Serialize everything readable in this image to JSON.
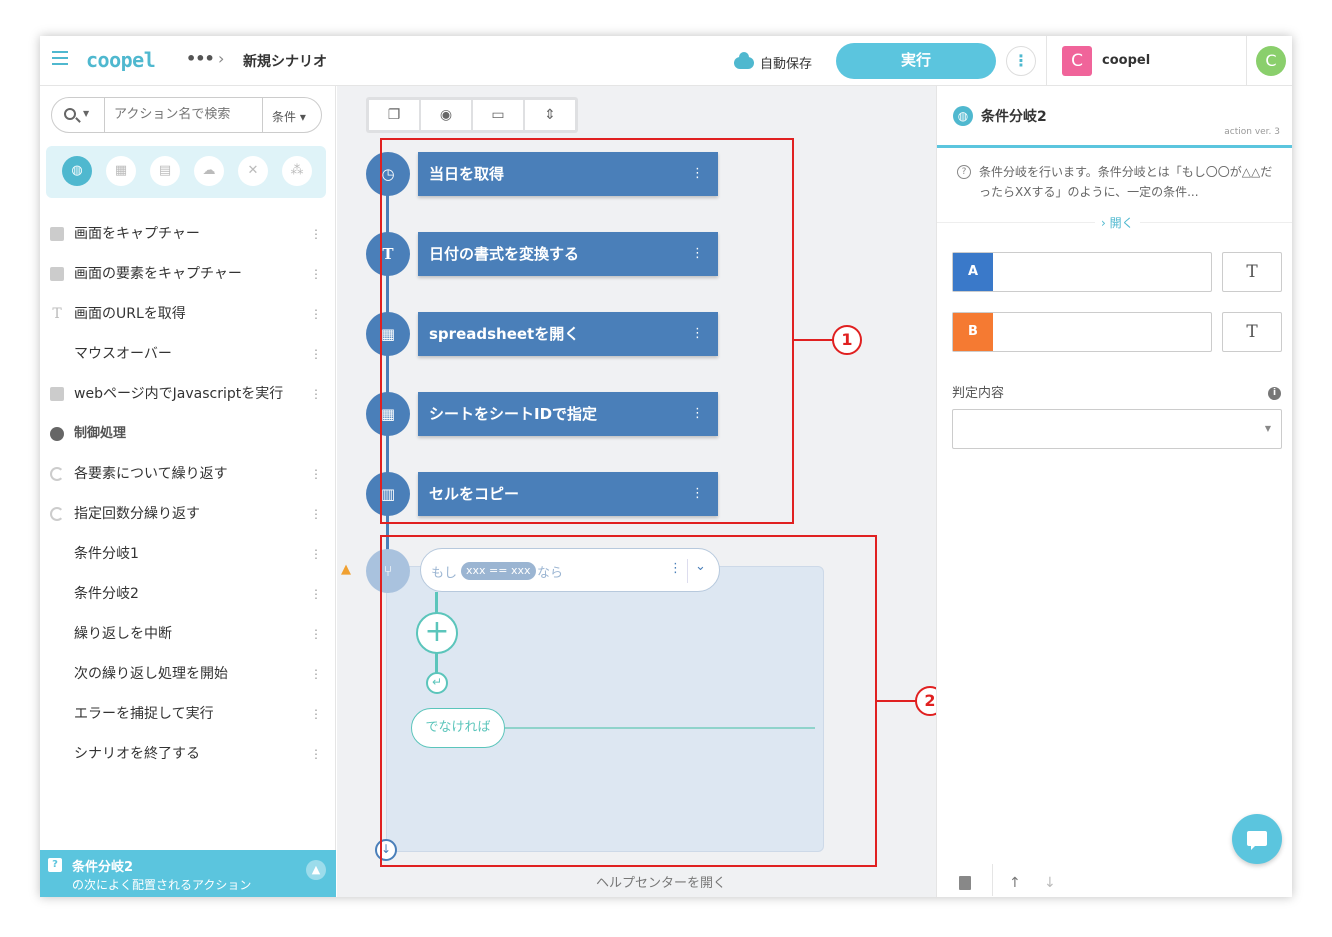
{
  "header": {
    "logo": "coopel",
    "more": "•••",
    "separator": "›",
    "title": "新規シナリオ",
    "autosave": "自動保存",
    "run": "実行",
    "kebab": "⋮",
    "workspace_initial": "C",
    "workspace_name": "coopel",
    "user_initial": "C"
  },
  "sidebar": {
    "search_placeholder": "アクション名で検索",
    "condition_filter": "条件",
    "items": [
      {
        "label": "画面をキャプチャー"
      },
      {
        "label": "画面の要素をキャプチャー"
      },
      {
        "label": "画面のURLを取得"
      },
      {
        "label": "マウスオーバー"
      },
      {
        "label": "webページ内でJavascriptを実行"
      },
      {
        "label": "制御処理"
      },
      {
        "label": "各要素について繰り返す"
      },
      {
        "label": "指定回数分繰り返す"
      },
      {
        "label": "条件分岐1"
      },
      {
        "label": "条件分岐2"
      },
      {
        "label": "繰り返しを中断"
      },
      {
        "label": "次の繰り返し処理を開始"
      },
      {
        "label": "エラーを捕捉して実行"
      },
      {
        "label": "シナリオを終了する"
      }
    ],
    "suggestion_title": "条件分岐2",
    "suggestion_sub": "の次によく配置されるアクション"
  },
  "canvas": {
    "actions": [
      {
        "label": "当日を取得"
      },
      {
        "label": "日付の書式を変換する"
      },
      {
        "label": "spreadsheetを開く"
      },
      {
        "label": "シートをシートIDで指定"
      },
      {
        "label": "セルをコピー"
      }
    ],
    "condition": {
      "if_text": "もし",
      "expr": "xxx == xxx",
      "then_text": "なら",
      "else_text": "でなければ"
    },
    "callouts": [
      "1",
      "2"
    ],
    "help": "ヘルプセンターを開く"
  },
  "panel": {
    "title": "条件分岐2",
    "version": "action ver. 3",
    "description": "条件分岐を行います。条件分岐とは「もし〇〇が△△だったらXXする」のように、一定の条件...",
    "open": "› 開く",
    "field_a": "A",
    "field_b": "B",
    "type_t": "T",
    "judge_label": "判定内容",
    "colors": {
      "a": "#3a79c9",
      "b": "#f57a32"
    }
  }
}
